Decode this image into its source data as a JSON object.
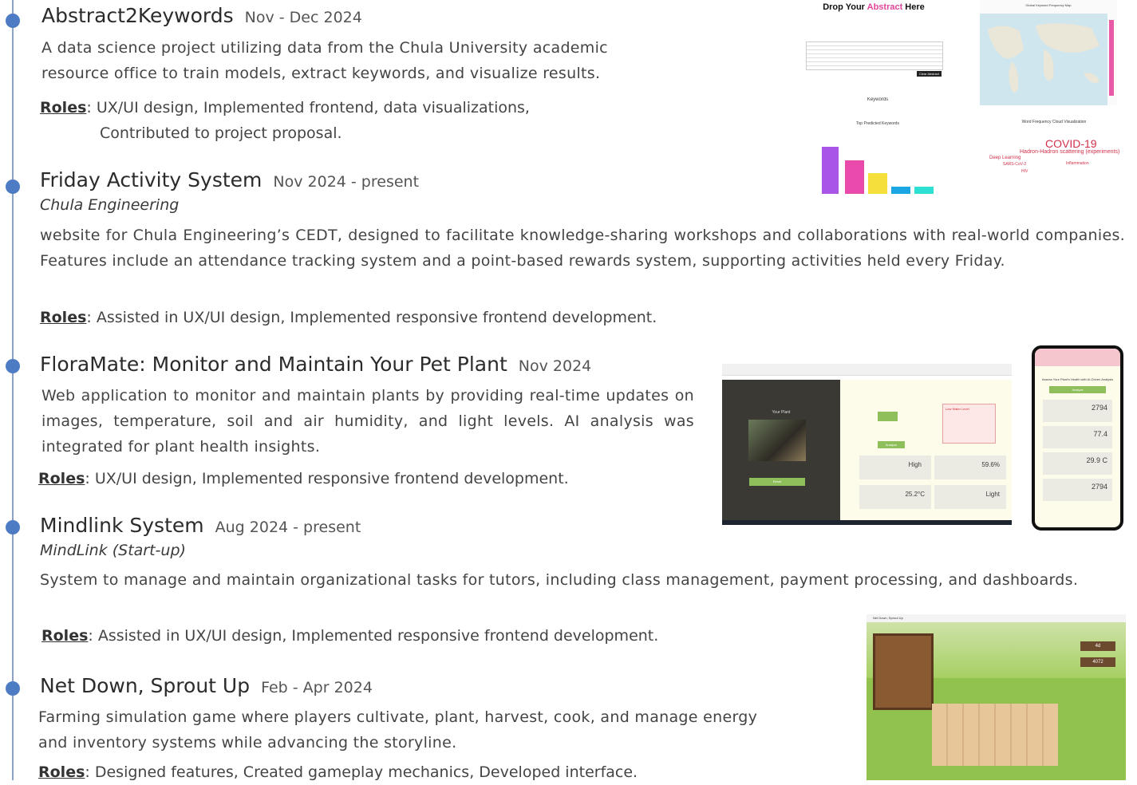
{
  "projects": [
    {
      "title": "Abstract2Keywords",
      "date": "Nov - Dec 2024",
      "desc": "A data science project utilizing data from the Chula University academic resource office to train models, extract keywords, and visualize results.",
      "roles_label": "Roles",
      "roles_line1": ": UX/UI design, Implemented frontend, data visualizations,",
      "roles_line2": "Contributed to project proposal."
    },
    {
      "title": "Friday Activity System",
      "date": "Nov 2024 - present",
      "org": "Chula Engineering",
      "desc": "website for Chula Engineering’s CEDT, designed to facilitate knowledge-sharing workshops and collaborations with real-world companies. Features include an attendance tracking system and a point-based rewards system, supporting activities held every Friday.",
      "roles_label": "Roles",
      "roles": ": Assisted in UX/UI design, Implemented responsive frontend development."
    },
    {
      "title": "FloraMate: Monitor and Maintain Your Pet Plant",
      "date": "Nov 2024",
      "desc": "Web application to monitor and maintain plants by providing real-time updates on images, temperature, soil and air humidity, and light levels. AI analysis was integrated for plant health insights.",
      "roles_label": "Roles",
      "roles": ": UX/UI design, Implemented responsive frontend development."
    },
    {
      "title": "Mindlink System",
      "date": "Aug 2024 - present",
      "org": "MindLink (Start-up)",
      "desc": "System to manage and maintain organizational tasks for tutors, including class management, payment processing, and dashboards.",
      "roles_label": "Roles",
      "roles": ": Assisted in UX/UI design, Implemented responsive frontend development."
    },
    {
      "title": "Net Down, Sprout Up",
      "date": "Feb - Apr 2024",
      "desc": "Farming simulation game where players cultivate, plant, harvest, cook, and manage energy and inventory systems while advancing the storyline.",
      "roles_label": "Roles",
      "roles": ": Designed features, Created gameplay mechanics, Developed interface."
    }
  ],
  "thumbs": {
    "a2k_heading_pre": "Drop Your ",
    "a2k_heading_hl": "Abstract",
    "a2k_heading_post": " Here",
    "a2k_button": "Clear Abstract",
    "a2k_keywords": "Keywords",
    "a2k_map_title": "Global Keyword Frequency Map",
    "a2k_bar_title": "Top Predicted Keywords",
    "a2k_cloud_title": "Word Frequency Cloud Visualization",
    "a2k_cloud_big": "COVID-19",
    "a2k_cloud_mid": "Hadron-Hadron scattering (experiments)",
    "a2k_cloud_w1": "Deep Learning",
    "a2k_cloud_w2": "SARS-CoV-2",
    "a2k_cloud_w3": "Inflammation",
    "a2k_cloud_w4": "HIV",
    "fm_your_plant": "Your Plant",
    "fm_low_water": "Low Water Level",
    "fm_analyze": "Analyze",
    "fm_reset": "Reset",
    "fm_humidity_soil": "High",
    "fm_humidity_air": "59.6%",
    "fm_temp": "25.2°C",
    "fm_light": "Light",
    "ph_header": "Assess Your Plant's Health with AI-Driven Analysis",
    "ph_analyze": "Analyze",
    "ph_v1": "2794",
    "ph_v2": "77.4",
    "ph_v3": "29.9 C",
    "ph_v4": "2794",
    "game_title": "Net Down, Sprout Up",
    "game_c1": "4d",
    "game_c2": "4072"
  }
}
